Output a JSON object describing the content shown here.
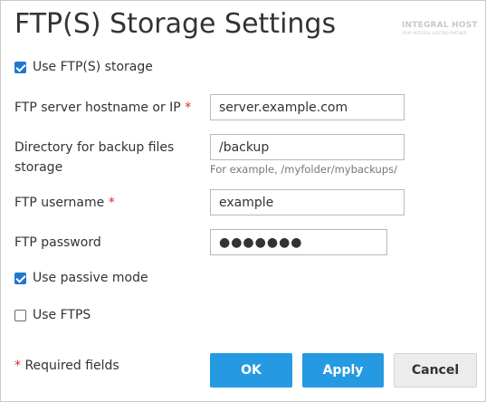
{
  "dialog": {
    "title": "FTP(S) Storage Settings",
    "watermark": {
      "name": "INTEGRAL HOST",
      "tagline": "YOUR INTEGRAL HOSTING PARTNER"
    }
  },
  "form": {
    "use_ftp_storage": {
      "label": "Use FTP(S) storage",
      "checked": true
    },
    "hostname": {
      "label": "FTP server hostname or IP",
      "required_mark": "*",
      "value": "server.example.com"
    },
    "directory": {
      "label_line1": "Directory for backup files",
      "label_line2": "storage",
      "value": "/backup",
      "hint": "For example, /myfolder/mybackups/"
    },
    "username": {
      "label": "FTP username",
      "required_mark": "*",
      "value": "example"
    },
    "password": {
      "label": "FTP password",
      "value": "●●●●●●●"
    },
    "passive_mode": {
      "label": "Use passive mode",
      "checked": true
    },
    "ftps": {
      "label": "Use FTPS",
      "checked": false
    }
  },
  "footer": {
    "required_mark": "*",
    "required_note": "Required fields",
    "ok_label": "OK",
    "apply_label": "Apply",
    "cancel_label": "Cancel"
  },
  "colors": {
    "primary_button": "#259ae2",
    "checkbox_checked": "#1f77d0",
    "required_asterisk": "#d9262c"
  }
}
